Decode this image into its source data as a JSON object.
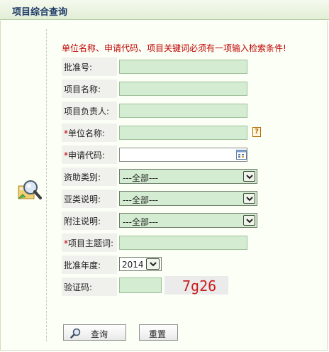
{
  "header": {
    "title": "项目综合查询"
  },
  "notice": "单位名称、申请代码、项目关键词必须有一项输入检索条件!",
  "form": {
    "approval_no": {
      "label": "批准号:",
      "value": ""
    },
    "project_name": {
      "label": "项目名称:",
      "value": ""
    },
    "project_leader": {
      "label": "项目负责人:",
      "value": ""
    },
    "unit_name": {
      "required_mark": "*",
      "label": "单位名称:",
      "value": ""
    },
    "apply_code": {
      "required_mark": "*",
      "label": "申请代码:",
      "value": ""
    },
    "funding_type": {
      "label": "资助类别:",
      "selected": "---全部---"
    },
    "subtype_desc": {
      "label": "亚类说明:",
      "selected": "---全部---"
    },
    "note_desc": {
      "label": "附注说明:",
      "selected": "---全部---"
    },
    "project_keyword": {
      "required_mark": "*",
      "label": "项目主题词:",
      "value": ""
    },
    "approval_year": {
      "label": "批准年度:",
      "selected": "2014"
    },
    "captcha": {
      "label": "验证码:",
      "value": "",
      "image_text": "7g26"
    }
  },
  "buttons": {
    "search": "查询",
    "reset": "重置"
  },
  "icons": {
    "search_panel": "magnifier-icon",
    "help": "help-icon",
    "picker": "calendar-picker-icon",
    "search_button": "magnifier-icon"
  },
  "colors": {
    "notice": "#c00000",
    "field_bg": "#d4ecd1",
    "header_text": "#1c3a67"
  }
}
